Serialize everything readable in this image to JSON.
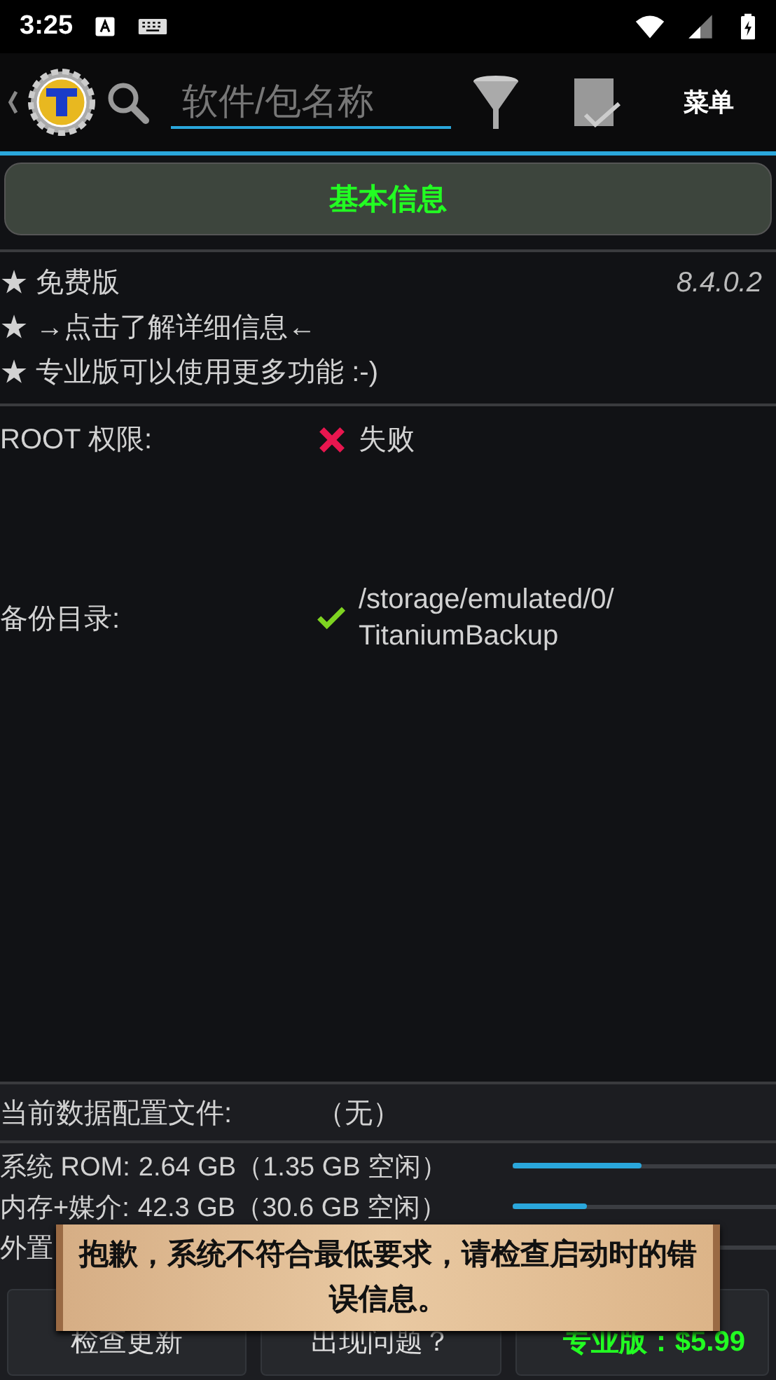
{
  "status_bar": {
    "time": "3:25"
  },
  "toolbar": {
    "search": {
      "placeholder": "软件/包名称"
    },
    "menu": "菜单"
  },
  "tab": {
    "label": "基本信息",
    "selected": true
  },
  "info": {
    "lines": [
      "★ 免费版",
      "★  →点击了解详细信息←",
      "★ 专业版可以使用更多功能 :-)"
    ],
    "version": "8.4.0.2"
  },
  "status_rows": [
    {
      "label": "ROOT 权限:",
      "ok": false,
      "value_lines": [
        "失败"
      ]
    },
    {
      "label": "备份目录:",
      "ok": true,
      "value_lines": [
        "/storage/emulated/0/",
        "TitaniumBackup"
      ]
    }
  ],
  "profile": {
    "label": "当前数据配置文件:",
    "value": "（无）"
  },
  "storage": [
    {
      "label": "系统 ROM:",
      "value": "2.64 GB（1.35 GB 空闲）",
      "level": 0.49
    },
    {
      "label": "内存+媒介:",
      "value": "42.3 GB（30.6 GB 空闲）",
      "level": 0.28
    },
    {
      "label": "外置"
    }
  ],
  "buttons": [
    {
      "label": "检查更新",
      "kind": "normal"
    },
    {
      "label": "出现问题？",
      "kind": "normal"
    },
    {
      "label": "专业版：$5.99",
      "kind": "pro"
    }
  ],
  "toast": {
    "message": "抱歉，系统不符合最低要求，请检查启动时的错误信息。"
  }
}
